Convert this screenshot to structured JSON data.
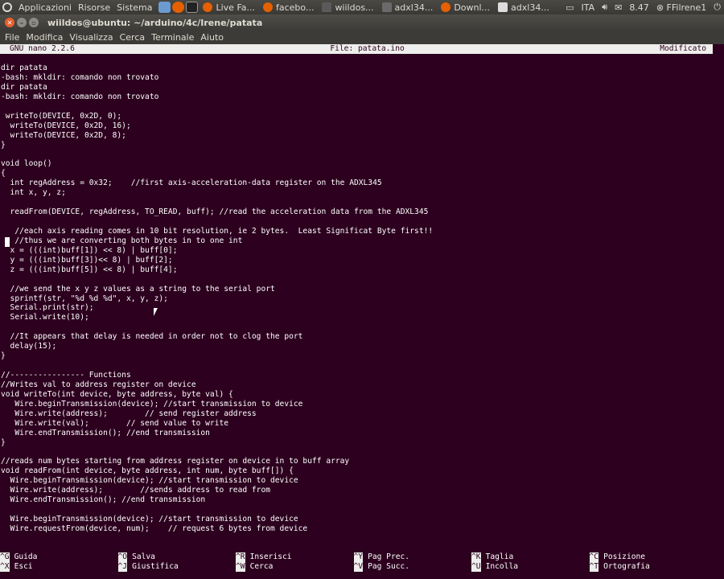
{
  "top_panel": {
    "menus": [
      "Applicazioni",
      "Risorse",
      "Sistema"
    ],
    "tasks": [
      {
        "label": "Live Fa...",
        "color": "#e66000"
      },
      {
        "label": "facebo...",
        "color": "#e66000"
      },
      {
        "label": "wiildos...",
        "color": "#5a5a5a"
      },
      {
        "label": "adxl34...",
        "color": "#6a6a6a"
      },
      {
        "label": "Downl...",
        "color": "#e66000"
      },
      {
        "label": "adxl34...",
        "color": "#6a6a6a"
      }
    ],
    "keyboard_layout": "ITA",
    "clock": "8.47",
    "user": "FFilrene1"
  },
  "window": {
    "title": "wiildos@ubuntu: ~/arduino/4c/Irene/patata"
  },
  "menubar": [
    "File",
    "Modifica",
    "Visualizza",
    "Cerca",
    "Terminale",
    "Aiuto"
  ],
  "nano": {
    "version": "GNU nano 2.2.6",
    "file": "File: patata.ino",
    "status": "Modificato"
  },
  "editor_lines": [
    "dir patata",
    "-bash: mkldir: comando non trovato",
    "dir patata",
    "-bash: mkldir: comando non trovato",
    "",
    " writeTo(DEVICE, 0x2D, 0);",
    "  writeTo(DEVICE, 0x2D, 16);",
    "  writeTo(DEVICE, 0x2D, 8);",
    "}",
    "",
    "void loop()",
    "{",
    "  int regAddress = 0x32;    //first axis-acceleration-data register on the ADXL345",
    "  int x, y, z;",
    "",
    "  readFrom(DEVICE, regAddress, TO_READ, buff); //read the acceleration data from the ADXL345",
    "",
    "   //each axis reading comes in 10 bit resolution, ie 2 bytes.  Least Significat Byte first!!",
    "   //thus we are converting both bytes in to one int",
    "  x = (((int)buff[1]) << 8) | buff[0];",
    "  y = (((int)buff[3])<< 8) | buff[2];",
    "  z = (((int)buff[5]) << 8) | buff[4];",
    "",
    "  //we send the x y z values as a string to the serial port",
    "  sprintf(str, \"%d %d %d\", x, y, z);",
    "  Serial.print(str);",
    "  Serial.write(10);",
    "",
    "  //It appears that delay is needed in order not to clog the port",
    "  delay(15);",
    "}",
    "",
    "//---------------- Functions",
    "//Writes val to address register on device",
    "void writeTo(int device, byte address, byte val) {",
    "   Wire.beginTransmission(device); //start transmission to device",
    "   Wire.write(address);        // send register address",
    "   Wire.write(val);        // send value to write",
    "   Wire.endTransmission(); //end transmission",
    "}",
    "",
    "//reads num bytes starting from address register on device in to buff array",
    "void readFrom(int device, byte address, int num, byte buff[]) {",
    "  Wire.beginTransmission(device); //start transmission to device",
    "  Wire.write(address);        //sends address to read from",
    "  Wire.endTransmission(); //end transmission",
    "",
    "  Wire.beginTransmission(device); //start transmission to device",
    "  Wire.requestFrom(device, num);    // request 6 bytes from device"
  ],
  "shortcuts": [
    {
      "key": "^G",
      "label": "Guida"
    },
    {
      "key": "^O",
      "label": "Salva"
    },
    {
      "key": "^R",
      "label": "Inserisci"
    },
    {
      "key": "^Y",
      "label": "Pag Prec."
    },
    {
      "key": "^K",
      "label": "Taglia"
    },
    {
      "key": "^C",
      "label": "Posizione"
    },
    {
      "key": "^X",
      "label": "Esci"
    },
    {
      "key": "^J",
      "label": "Giustifica"
    },
    {
      "key": "^W",
      "label": "Cerca"
    },
    {
      "key": "^V",
      "label": "Pag Succ."
    },
    {
      "key": "^U",
      "label": "Incolla"
    },
    {
      "key": "^T",
      "label": "Ortografia"
    }
  ]
}
